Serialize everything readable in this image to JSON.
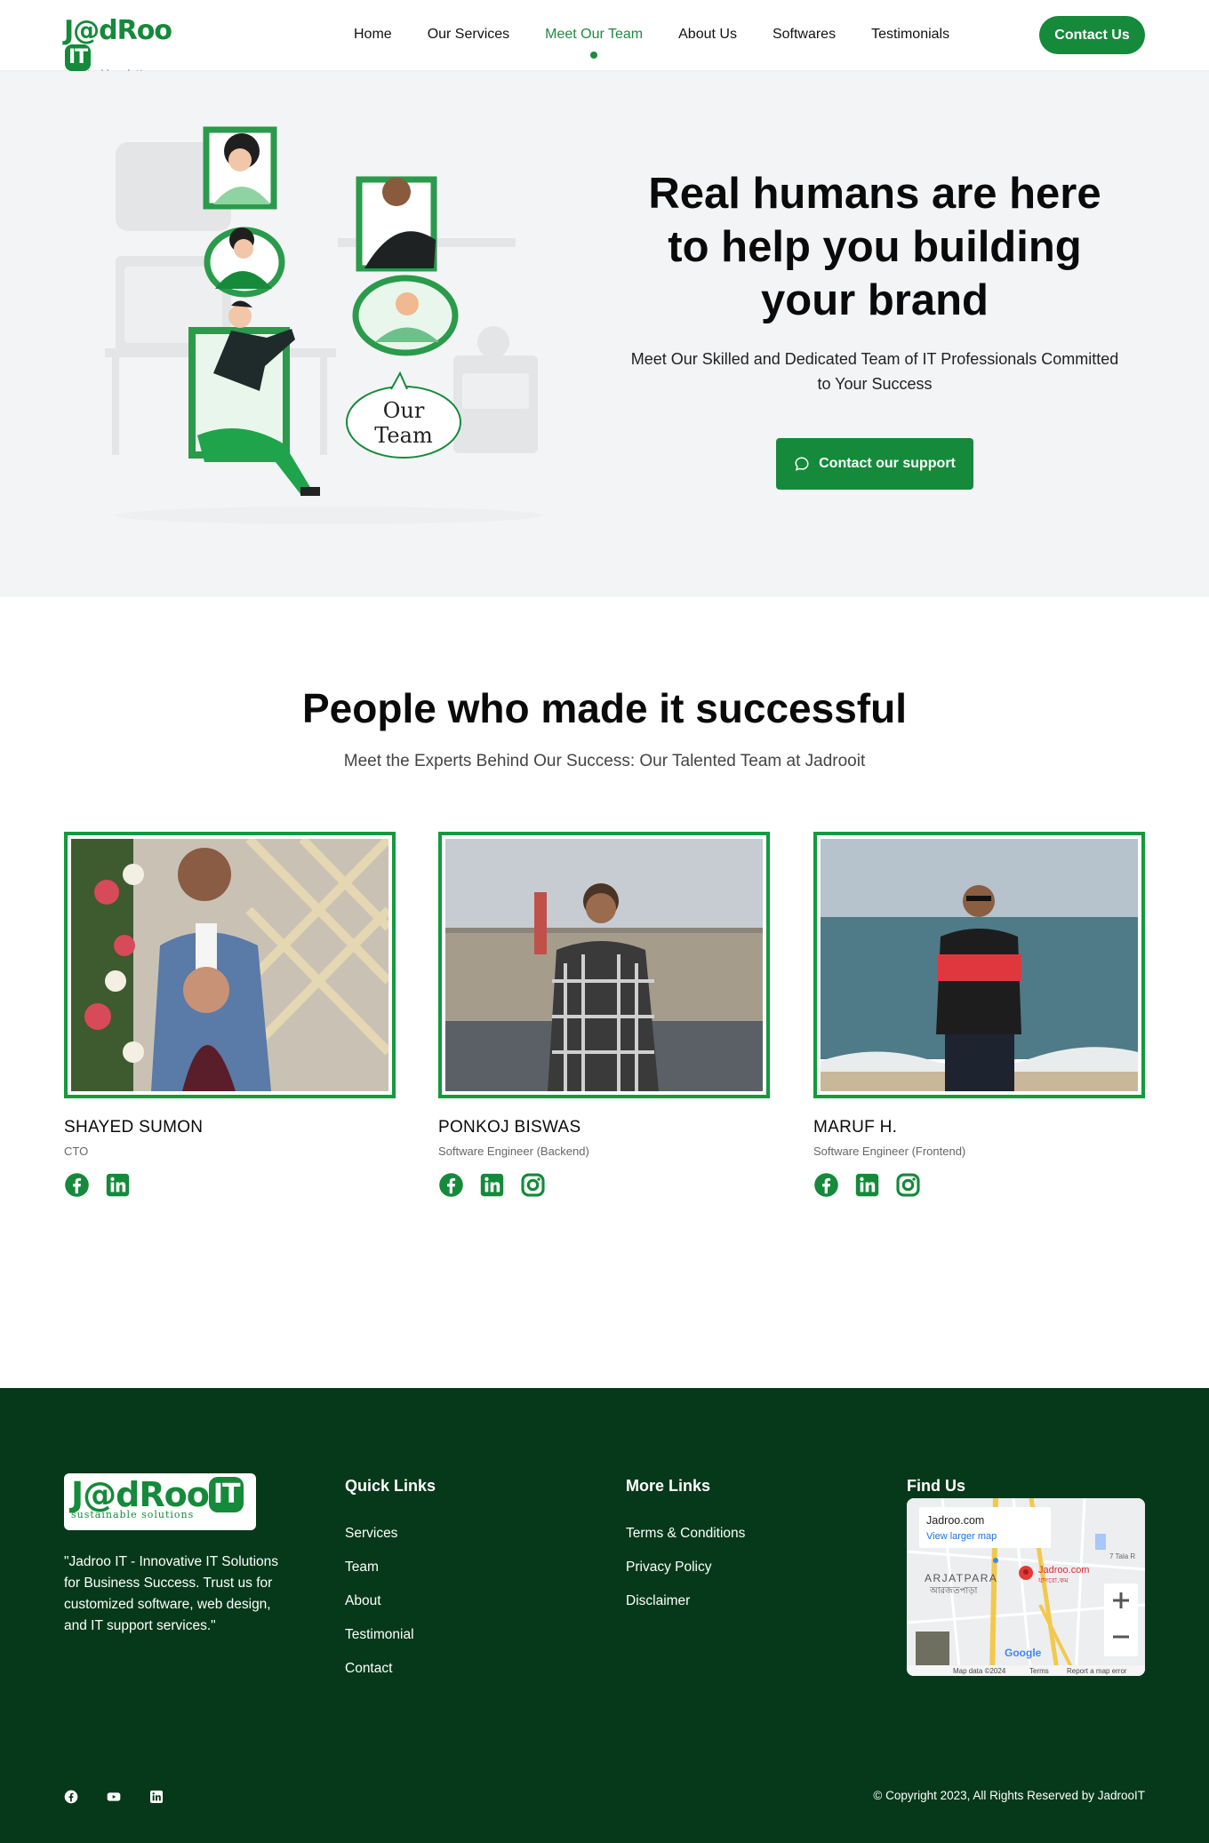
{
  "nav": {
    "logo": {
      "word": "J@dRoo",
      "it": "IT",
      "tagline": "sustainable solutions"
    },
    "items": [
      {
        "label": "Home",
        "active": false
      },
      {
        "label": "Our Services",
        "active": false
      },
      {
        "label": "Meet Our Team",
        "active": true
      },
      {
        "label": "About Us",
        "active": false
      },
      {
        "label": "Softwares",
        "active": false
      },
      {
        "label": "Testimonials",
        "active": false
      }
    ],
    "contact_label": "Contact Us"
  },
  "hero": {
    "title_line1": "Real humans are here",
    "title_line2": "to help you building",
    "title_line3": "your brand",
    "subtitle": "Meet Our Skilled and Dedicated Team of IT Professionals Committed to Your Success",
    "button_label": "Contact our support",
    "art_badge_line1": "Our",
    "art_badge_line2": "Team"
  },
  "team": {
    "title": "People who made it successful",
    "subtitle": "Meet the Experts Behind Our Success: Our Talented Team at Jadrooit",
    "members": [
      {
        "name": "SHAYED SUMON",
        "role": "CTO",
        "socials": [
          "facebook-icon",
          "linkedin-icon"
        ]
      },
      {
        "name": "PONKOJ BISWAS",
        "role": "Software Engineer (Backend)",
        "socials": [
          "facebook-icon",
          "linkedin-icon",
          "instagram-icon"
        ]
      },
      {
        "name": "MARUF H.",
        "role": "Software Engineer (Frontend)",
        "socials": [
          "facebook-icon",
          "linkedin-icon",
          "instagram-icon"
        ]
      }
    ]
  },
  "footer": {
    "description": "\"Jadroo IT - Innovative IT Solutions for Business Success. Trust us for customized software, web design, and IT support services.\"",
    "quick_links_title": "Quick Links",
    "quick_links": [
      "Services",
      "Team",
      "About",
      "Testimonial",
      "Contact"
    ],
    "more_links_title": "More Links",
    "more_links": [
      "Terms & Conditions",
      "Privacy Policy",
      "Disclaimer"
    ],
    "find_us_title": "Find Us",
    "map": {
      "place_name": "Jadroo.com",
      "larger_map": "View larger map",
      "pin_label": "Jadroo.com",
      "pin_label_local": "যাদরো.কম",
      "area_label": "ARJATPARA",
      "area_label_local": "আরজতপাড়া",
      "road_label": "7 Tala R",
      "attribution": "Map data ©2024",
      "terms": "Terms",
      "report": "Report a map error",
      "google": "Google"
    },
    "social_icons": [
      "facebook-icon",
      "youtube-icon",
      "linkedin-icon"
    ],
    "copyright": "© Copyright 2023, All Rights Reserved by JadrooIT"
  },
  "colors": {
    "brand_green": "#148a3a",
    "footer_bg": "#06391a",
    "hero_bg": "#f3f4f5"
  }
}
